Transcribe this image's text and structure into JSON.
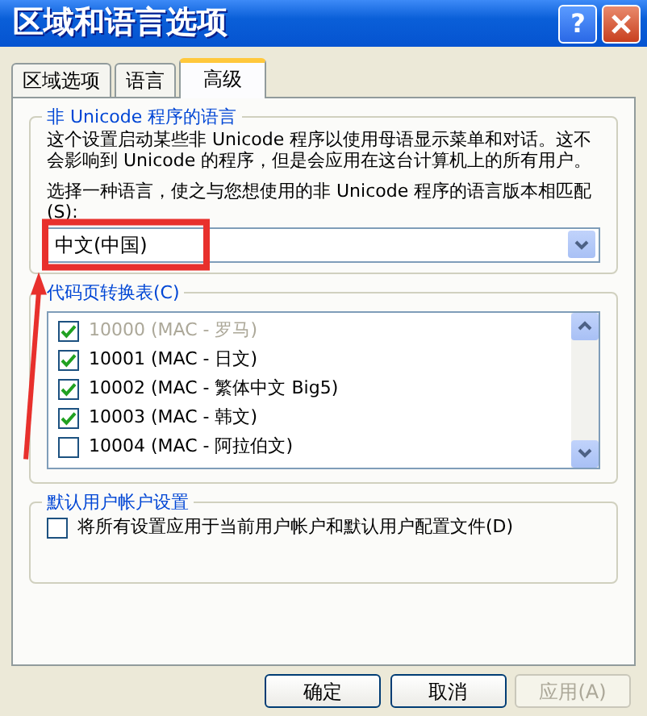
{
  "window": {
    "title": "区域和语言选项",
    "help_button": "?"
  },
  "tabs": [
    {
      "label": "区域选项",
      "selected": false
    },
    {
      "label": "语言",
      "selected": false
    },
    {
      "label": "高级",
      "selected": true
    }
  ],
  "non_unicode_group": {
    "title": "非 Unicode 程序的语言",
    "description": "这个设置启动某些非 Unicode 程序以使用母语显示菜单和对话。这不会影响到 Unicode 的程序，但是会应用在这台计算机上的所有用户。",
    "prompt": "选择一种语言，使之与您想使用的非 Unicode 程序的语言版本相匹配(S):",
    "language": "中文(中国)"
  },
  "code_page_group": {
    "title": "代码页转换表(C)",
    "items": [
      {
        "label": "10000 (MAC - 罗马)",
        "checked": true,
        "disabled": true
      },
      {
        "label": "10001 (MAC - 日文)",
        "checked": true,
        "disabled": false
      },
      {
        "label": "10002 (MAC - 繁体中文 Big5)",
        "checked": true,
        "disabled": false
      },
      {
        "label": "10003 (MAC - 韩文)",
        "checked": true,
        "disabled": false
      },
      {
        "label": "10004 (MAC - 阿拉伯文)",
        "checked": false,
        "disabled": false
      }
    ]
  },
  "default_user_group": {
    "title": "默认用户帐户设置",
    "option": {
      "label": "将所有设置应用于当前用户帐户和默认用户配置文件(D)",
      "checked": false
    }
  },
  "buttons": [
    {
      "label": "确定",
      "disabled": false
    },
    {
      "label": "取消",
      "disabled": false
    },
    {
      "label": "应用(A)",
      "disabled": true
    }
  ]
}
